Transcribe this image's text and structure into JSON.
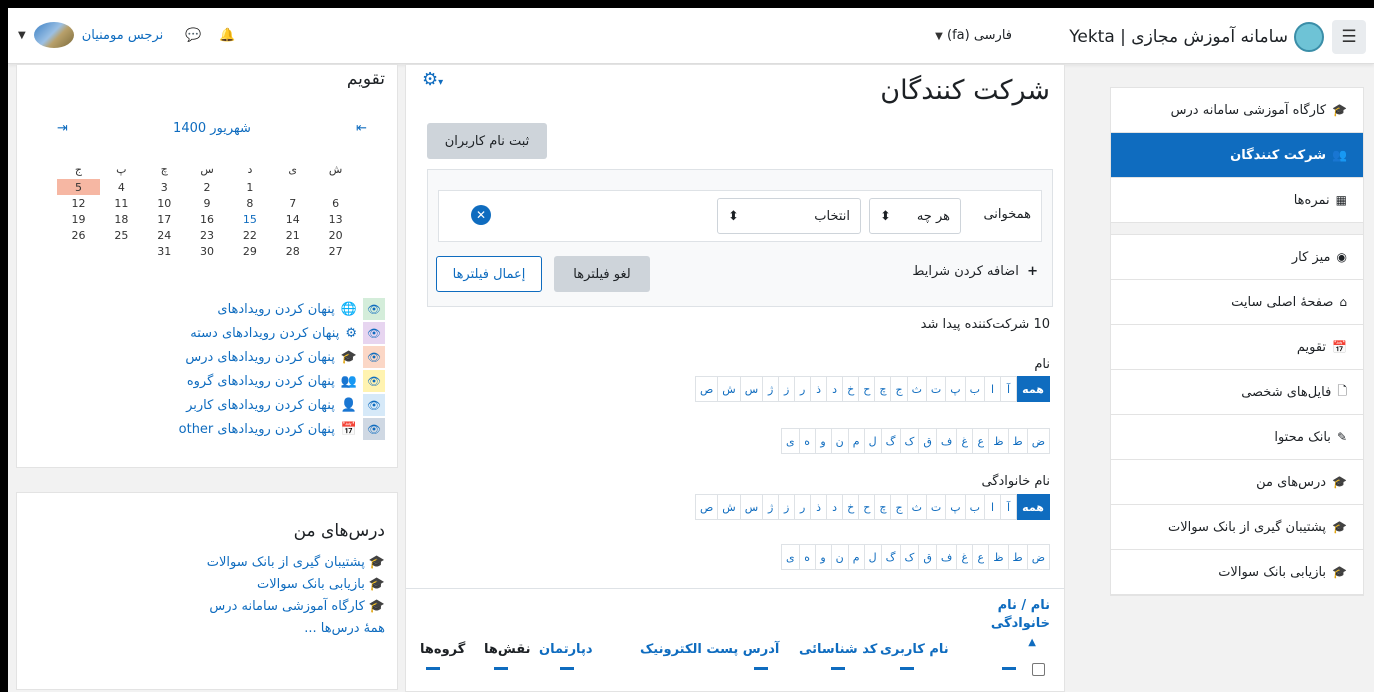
{
  "navbar": {
    "menu_icon": "hamburger-icon",
    "brand": "سامانه آموزش مجازی | Yekta",
    "language": "فارسی (fa)",
    "user_name": "نرجس مومنیان"
  },
  "calendar": {
    "title": "تقویم",
    "month": "شهریور 1400",
    "weekdays": [
      "ش",
      "ی",
      "د",
      "س",
      "چ",
      "پ",
      "ج"
    ],
    "weeks": [
      [
        "",
        "",
        "1",
        "2",
        "3",
        "4",
        "5"
      ],
      [
        "6",
        "7",
        "8",
        "9",
        "10",
        "11",
        "12"
      ],
      [
        "13",
        "14",
        "15",
        "16",
        "17",
        "18",
        "19"
      ],
      [
        "20",
        "21",
        "22",
        "23",
        "24",
        "25",
        "26"
      ],
      [
        "27",
        "28",
        "29",
        "30",
        "31",
        "",
        ""
      ]
    ],
    "today": "5",
    "legend": [
      {
        "label": "پنهان کردن رویدادهای",
        "icon": "globe-icon",
        "color": "#d4edda"
      },
      {
        "label": "پنهان کردن رویدادهای دسته",
        "icon": "cubes-icon",
        "color": "#e7d5f0"
      },
      {
        "label": "پنهان کردن رویدادهای درس",
        "icon": "graduation-cap-icon",
        "color": "#fbd7c6"
      },
      {
        "label": "پنهان کردن رویدادهای گروه",
        "icon": "users-icon",
        "color": "#fff3b0"
      },
      {
        "label": "پنهان کردن رویدادهای کاربر",
        "icon": "user-icon",
        "color": "#d6e9f8"
      },
      {
        "label": "پنهان کردن رویدادهای other",
        "icon": "calendar-icon",
        "color": "#cfd8e3"
      }
    ]
  },
  "my_courses": {
    "title": "درس‌های من",
    "items": [
      "پشتیبان گیری از بانک سوالات",
      "بازیابی بانک سوالات",
      "کارگاه آموزشی سامانه درس"
    ],
    "all": "همهٔ درس‌ها ..."
  },
  "main": {
    "title": "شرکت کنندگان",
    "enrol_button": "ثبت نام کاربران",
    "filter": {
      "match_label": "همخوانی",
      "match_value": "هر چه",
      "select_value": "انتخاب",
      "add_condition": "اضافه کردن شرایط",
      "clear": "لغو فیلترها",
      "apply": "إعمال فیلترها"
    },
    "found": "10 شرکت‌کننده پیدا شد",
    "first_name_label": "نام",
    "last_name_label": "نام خانوادگی",
    "all_label": "همه",
    "letters_row1": [
      "آ",
      "ا",
      "ب",
      "پ",
      "ت",
      "ث",
      "ج",
      "چ",
      "ح",
      "خ",
      "د",
      "ذ",
      "ر",
      "ز",
      "ژ",
      "س",
      "ش",
      "ص"
    ],
    "letters_row2": [
      "ض",
      "ط",
      "ظ",
      "ع",
      "غ",
      "ف",
      "ق",
      "ک",
      "گ",
      "ل",
      "م",
      "ن",
      "و",
      "ه",
      "ی"
    ],
    "columns": {
      "name": "نام / نام خانوادگی",
      "username": "نام کاربری",
      "idnumber": "کد شناسائی",
      "email": "آدرس پست الکترونیک",
      "department": "دپارتمان",
      "roles": "نقش‌ها",
      "groups": "گروه‌ها"
    }
  },
  "sidenav": {
    "items": [
      {
        "label": "کارگاه آموزشی سامانه درس",
        "icon": "graduation-cap-icon"
      },
      {
        "label": "شرکت کنندگان",
        "icon": "users-icon",
        "active": true
      },
      {
        "label": "نمره‌ها",
        "icon": "table-icon"
      },
      {
        "label": "میز کار",
        "icon": "dashboard-icon"
      },
      {
        "label": "صفحهٔ اصلی سایت",
        "icon": "home-icon"
      },
      {
        "label": "تقویم",
        "icon": "calendar-icon"
      },
      {
        "label": "فایل‌های شخصی",
        "icon": "file-icon"
      },
      {
        "label": "بانک محتوا",
        "icon": "paintbrush-icon"
      },
      {
        "label": "درس‌های من",
        "icon": "graduation-cap-icon"
      },
      {
        "label": "پشتیبان گیری از بانک سوالات",
        "icon": "graduation-cap-icon"
      },
      {
        "label": "بازیابی بانک سوالات",
        "icon": "graduation-cap-icon"
      }
    ]
  }
}
